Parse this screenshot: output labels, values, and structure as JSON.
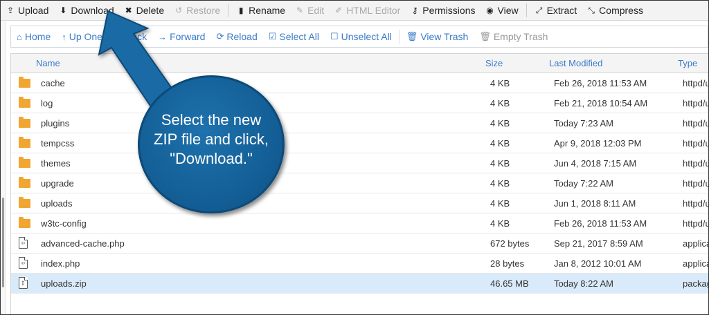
{
  "toolbar": {
    "items": [
      {
        "label": "Upload",
        "icon": "upload-icon",
        "enabled": true
      },
      {
        "label": "Download",
        "icon": "download-icon",
        "enabled": true
      },
      {
        "label": "Delete",
        "icon": "delete-icon",
        "enabled": true
      },
      {
        "label": "Restore",
        "icon": "restore-icon",
        "enabled": false
      },
      {
        "label": "Rename",
        "icon": "rename-icon",
        "enabled": true
      },
      {
        "label": "Edit",
        "icon": "pencil-icon",
        "enabled": false
      },
      {
        "label": "HTML Editor",
        "icon": "html-editor-icon",
        "enabled": false
      },
      {
        "label": "Permissions",
        "icon": "key-icon",
        "enabled": true
      },
      {
        "label": "View",
        "icon": "eye-icon",
        "enabled": true
      },
      {
        "label": "Extract",
        "icon": "expand-icon",
        "enabled": true
      },
      {
        "label": "Compress",
        "icon": "compress-icon",
        "enabled": true
      }
    ]
  },
  "nav": {
    "home": "Home",
    "up_one": "Up One",
    "back": "Back",
    "forward": "Forward",
    "reload": "Reload",
    "select_all": "Select All",
    "unselect_all": "Unselect All",
    "view_trash": "View Trash",
    "empty_trash": "Empty Trash"
  },
  "table": {
    "columns": {
      "name": "Name",
      "size": "Size",
      "modified": "Last Modified",
      "type": "Type"
    },
    "rows": [
      {
        "kind": "folder",
        "name": "cache",
        "size": "4 KB",
        "modified": "Feb 26, 2018 11:53 AM",
        "type": "httpd/u"
      },
      {
        "kind": "folder",
        "name": "log",
        "size": "4 KB",
        "modified": "Feb 21, 2018 10:54 AM",
        "type": "httpd/u"
      },
      {
        "kind": "folder",
        "name": "plugins",
        "size": "4 KB",
        "modified": "Today 7:23 AM",
        "type": "httpd/u"
      },
      {
        "kind": "folder",
        "name": "tempcss",
        "size": "4 KB",
        "modified": "Apr 9, 2018 12:03 PM",
        "type": "httpd/u"
      },
      {
        "kind": "folder",
        "name": "themes",
        "size": "4 KB",
        "modified": "Jun 4, 2018 7:15 AM",
        "type": "httpd/u"
      },
      {
        "kind": "folder",
        "name": "upgrade",
        "size": "4 KB",
        "modified": "Today 7:22 AM",
        "type": "httpd/u"
      },
      {
        "kind": "folder",
        "name": "uploads",
        "size": "4 KB",
        "modified": "Jun 1, 2018 8:11 AM",
        "type": "httpd/u"
      },
      {
        "kind": "folder",
        "name": "w3tc-config",
        "size": "4 KB",
        "modified": "Feb 26, 2018 11:53 AM",
        "type": "httpd/u"
      },
      {
        "kind": "code",
        "name": "advanced-cache.php",
        "size": "672 bytes",
        "modified": "Sep 21, 2017 8:59 AM",
        "type": "applica"
      },
      {
        "kind": "code",
        "name": "index.php",
        "size": "28 bytes",
        "modified": "Jan 8, 2012 10:01 AM",
        "type": "applica"
      },
      {
        "kind": "zip",
        "name": "uploads.zip",
        "size": "46.65 MB",
        "modified": "Today 8:22 AM",
        "type": "packag",
        "selected": true
      }
    ]
  },
  "callout": {
    "line1": "Select the new",
    "line2": "ZIP file and click,",
    "line3": "\"Download.\""
  },
  "colors": {
    "link": "#3a7ac9",
    "folder": "#f0a630",
    "selected_row": "#d9ebfb",
    "callout": "#125c93"
  }
}
